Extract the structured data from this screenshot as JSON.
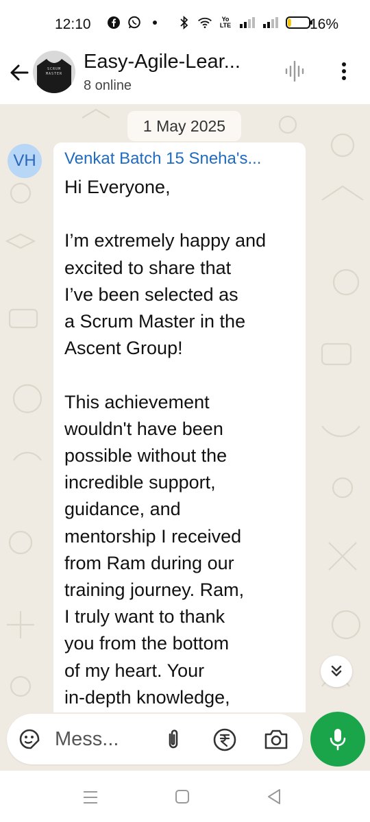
{
  "status_bar": {
    "time": "12:10",
    "network_label": "Yo LTE",
    "battery_percent": "16%",
    "battery_level": 0.16,
    "icons": [
      "facebook-icon",
      "whatsapp-icon",
      "notification-dot-icon",
      "bluetooth-icon",
      "wifi-icon",
      "volte-icon",
      "signal-icon",
      "signal-icon",
      "battery-icon"
    ]
  },
  "header": {
    "title": "Easy-Agile-Lear...",
    "subtitle": "8 online",
    "avatar_text": "SCRUM MASTER"
  },
  "chat": {
    "date_label": "1 May 2025",
    "message": {
      "sender_initials": "VH",
      "sender_name": "Venkat Batch 15 Sneha's...",
      "text": "Hi Everyone,\n\nI’m extremely happy and\nexcited to share that\nI’ve been selected as\na Scrum Master in the\nAscent Group!\n\nThis achievement\nwouldn't have been\npossible without the\nincredible support,\nguidance, and\nmentorship I received\nfrom Ram during our\ntraining journey. Ram,\nI truly want to thank\nyou from the bottom\nof my heart. Your\nin-depth knowledge,"
    }
  },
  "composer": {
    "placeholder": "Mess..."
  },
  "colors": {
    "accent_green": "#1aa54b",
    "sender_name": "#1f6bbf",
    "chat_background": "#efeae2",
    "avatar_background": "#b8d6f6"
  }
}
